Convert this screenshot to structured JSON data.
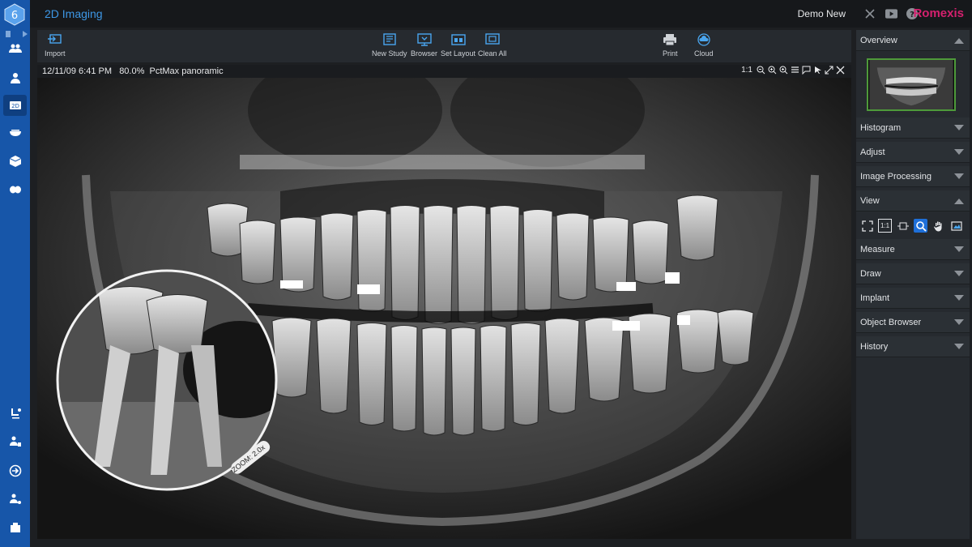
{
  "app": {
    "title": "2D Imaging",
    "user": "Demo New",
    "brand": "Romexis"
  },
  "toolbar": {
    "import": "Import",
    "new_study": "New Study",
    "browser": "Browser",
    "set_layout": "Set Layout",
    "clean_all": "Clean All",
    "print": "Print",
    "cloud": "Cloud"
  },
  "image": {
    "info": "12/11/09 6:41 PM   80.0%  PctMax panoramic",
    "scale_label": "1:1",
    "zoom_badge": "ZOOM: 2.0x"
  },
  "panel": {
    "overview": "Overview",
    "histogram": "Histogram",
    "adjust": "Adjust",
    "image_processing": "Image Processing",
    "view": "View",
    "measure": "Measure",
    "draw": "Draw",
    "implant": "Implant",
    "object_browser": "Object Browser",
    "history": "History"
  },
  "view_tools": {
    "one_to_one": "1:1"
  },
  "colors": {
    "rail": "#1756a9",
    "title_accent": "#3d97e6",
    "brand": "#d4206e",
    "selected_tool": "#1e6fd9",
    "thumb_border": "#4e9a3a"
  },
  "icons": {
    "rail": [
      "home-icon",
      "users-icon",
      "patient-icon",
      "2d-imaging-icon",
      "intraoral-icon",
      "3d-cube-icon",
      "oval-icon",
      "dental-chair-icon",
      "person-card-icon",
      "export-icon",
      "user-settings-icon",
      "plugins-icon"
    ]
  }
}
